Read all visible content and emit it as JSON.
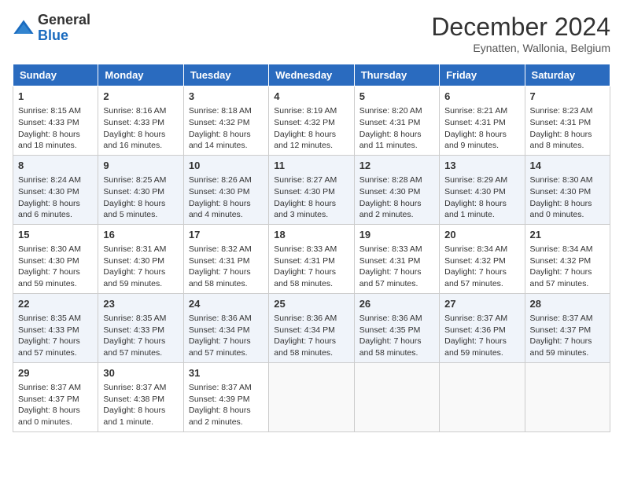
{
  "header": {
    "logo_general": "General",
    "logo_blue": "Blue",
    "title": "December 2024",
    "location": "Eynatten, Wallonia, Belgium"
  },
  "days_of_week": [
    "Sunday",
    "Monday",
    "Tuesday",
    "Wednesday",
    "Thursday",
    "Friday",
    "Saturday"
  ],
  "weeks": [
    [
      {
        "day": "1",
        "lines": [
          "Sunrise: 8:15 AM",
          "Sunset: 4:33 PM",
          "Daylight: 8 hours",
          "and 18 minutes."
        ]
      },
      {
        "day": "2",
        "lines": [
          "Sunrise: 8:16 AM",
          "Sunset: 4:33 PM",
          "Daylight: 8 hours",
          "and 16 minutes."
        ]
      },
      {
        "day": "3",
        "lines": [
          "Sunrise: 8:18 AM",
          "Sunset: 4:32 PM",
          "Daylight: 8 hours",
          "and 14 minutes."
        ]
      },
      {
        "day": "4",
        "lines": [
          "Sunrise: 8:19 AM",
          "Sunset: 4:32 PM",
          "Daylight: 8 hours",
          "and 12 minutes."
        ]
      },
      {
        "day": "5",
        "lines": [
          "Sunrise: 8:20 AM",
          "Sunset: 4:31 PM",
          "Daylight: 8 hours",
          "and 11 minutes."
        ]
      },
      {
        "day": "6",
        "lines": [
          "Sunrise: 8:21 AM",
          "Sunset: 4:31 PM",
          "Daylight: 8 hours",
          "and 9 minutes."
        ]
      },
      {
        "day": "7",
        "lines": [
          "Sunrise: 8:23 AM",
          "Sunset: 4:31 PM",
          "Daylight: 8 hours",
          "and 8 minutes."
        ]
      }
    ],
    [
      {
        "day": "8",
        "lines": [
          "Sunrise: 8:24 AM",
          "Sunset: 4:30 PM",
          "Daylight: 8 hours",
          "and 6 minutes."
        ]
      },
      {
        "day": "9",
        "lines": [
          "Sunrise: 8:25 AM",
          "Sunset: 4:30 PM",
          "Daylight: 8 hours",
          "and 5 minutes."
        ]
      },
      {
        "day": "10",
        "lines": [
          "Sunrise: 8:26 AM",
          "Sunset: 4:30 PM",
          "Daylight: 8 hours",
          "and 4 minutes."
        ]
      },
      {
        "day": "11",
        "lines": [
          "Sunrise: 8:27 AM",
          "Sunset: 4:30 PM",
          "Daylight: 8 hours",
          "and 3 minutes."
        ]
      },
      {
        "day": "12",
        "lines": [
          "Sunrise: 8:28 AM",
          "Sunset: 4:30 PM",
          "Daylight: 8 hours",
          "and 2 minutes."
        ]
      },
      {
        "day": "13",
        "lines": [
          "Sunrise: 8:29 AM",
          "Sunset: 4:30 PM",
          "Daylight: 8 hours",
          "and 1 minute."
        ]
      },
      {
        "day": "14",
        "lines": [
          "Sunrise: 8:30 AM",
          "Sunset: 4:30 PM",
          "Daylight: 8 hours",
          "and 0 minutes."
        ]
      }
    ],
    [
      {
        "day": "15",
        "lines": [
          "Sunrise: 8:30 AM",
          "Sunset: 4:30 PM",
          "Daylight: 7 hours",
          "and 59 minutes."
        ]
      },
      {
        "day": "16",
        "lines": [
          "Sunrise: 8:31 AM",
          "Sunset: 4:30 PM",
          "Daylight: 7 hours",
          "and 59 minutes."
        ]
      },
      {
        "day": "17",
        "lines": [
          "Sunrise: 8:32 AM",
          "Sunset: 4:31 PM",
          "Daylight: 7 hours",
          "and 58 minutes."
        ]
      },
      {
        "day": "18",
        "lines": [
          "Sunrise: 8:33 AM",
          "Sunset: 4:31 PM",
          "Daylight: 7 hours",
          "and 58 minutes."
        ]
      },
      {
        "day": "19",
        "lines": [
          "Sunrise: 8:33 AM",
          "Sunset: 4:31 PM",
          "Daylight: 7 hours",
          "and 57 minutes."
        ]
      },
      {
        "day": "20",
        "lines": [
          "Sunrise: 8:34 AM",
          "Sunset: 4:32 PM",
          "Daylight: 7 hours",
          "and 57 minutes."
        ]
      },
      {
        "day": "21",
        "lines": [
          "Sunrise: 8:34 AM",
          "Sunset: 4:32 PM",
          "Daylight: 7 hours",
          "and 57 minutes."
        ]
      }
    ],
    [
      {
        "day": "22",
        "lines": [
          "Sunrise: 8:35 AM",
          "Sunset: 4:33 PM",
          "Daylight: 7 hours",
          "and 57 minutes."
        ]
      },
      {
        "day": "23",
        "lines": [
          "Sunrise: 8:35 AM",
          "Sunset: 4:33 PM",
          "Daylight: 7 hours",
          "and 57 minutes."
        ]
      },
      {
        "day": "24",
        "lines": [
          "Sunrise: 8:36 AM",
          "Sunset: 4:34 PM",
          "Daylight: 7 hours",
          "and 57 minutes."
        ]
      },
      {
        "day": "25",
        "lines": [
          "Sunrise: 8:36 AM",
          "Sunset: 4:34 PM",
          "Daylight: 7 hours",
          "and 58 minutes."
        ]
      },
      {
        "day": "26",
        "lines": [
          "Sunrise: 8:36 AM",
          "Sunset: 4:35 PM",
          "Daylight: 7 hours",
          "and 58 minutes."
        ]
      },
      {
        "day": "27",
        "lines": [
          "Sunrise: 8:37 AM",
          "Sunset: 4:36 PM",
          "Daylight: 7 hours",
          "and 59 minutes."
        ]
      },
      {
        "day": "28",
        "lines": [
          "Sunrise: 8:37 AM",
          "Sunset: 4:37 PM",
          "Daylight: 7 hours",
          "and 59 minutes."
        ]
      }
    ],
    [
      {
        "day": "29",
        "lines": [
          "Sunrise: 8:37 AM",
          "Sunset: 4:37 PM",
          "Daylight: 8 hours",
          "and 0 minutes."
        ]
      },
      {
        "day": "30",
        "lines": [
          "Sunrise: 8:37 AM",
          "Sunset: 4:38 PM",
          "Daylight: 8 hours",
          "and 1 minute."
        ]
      },
      {
        "day": "31",
        "lines": [
          "Sunrise: 8:37 AM",
          "Sunset: 4:39 PM",
          "Daylight: 8 hours",
          "and 2 minutes."
        ]
      },
      null,
      null,
      null,
      null
    ]
  ]
}
